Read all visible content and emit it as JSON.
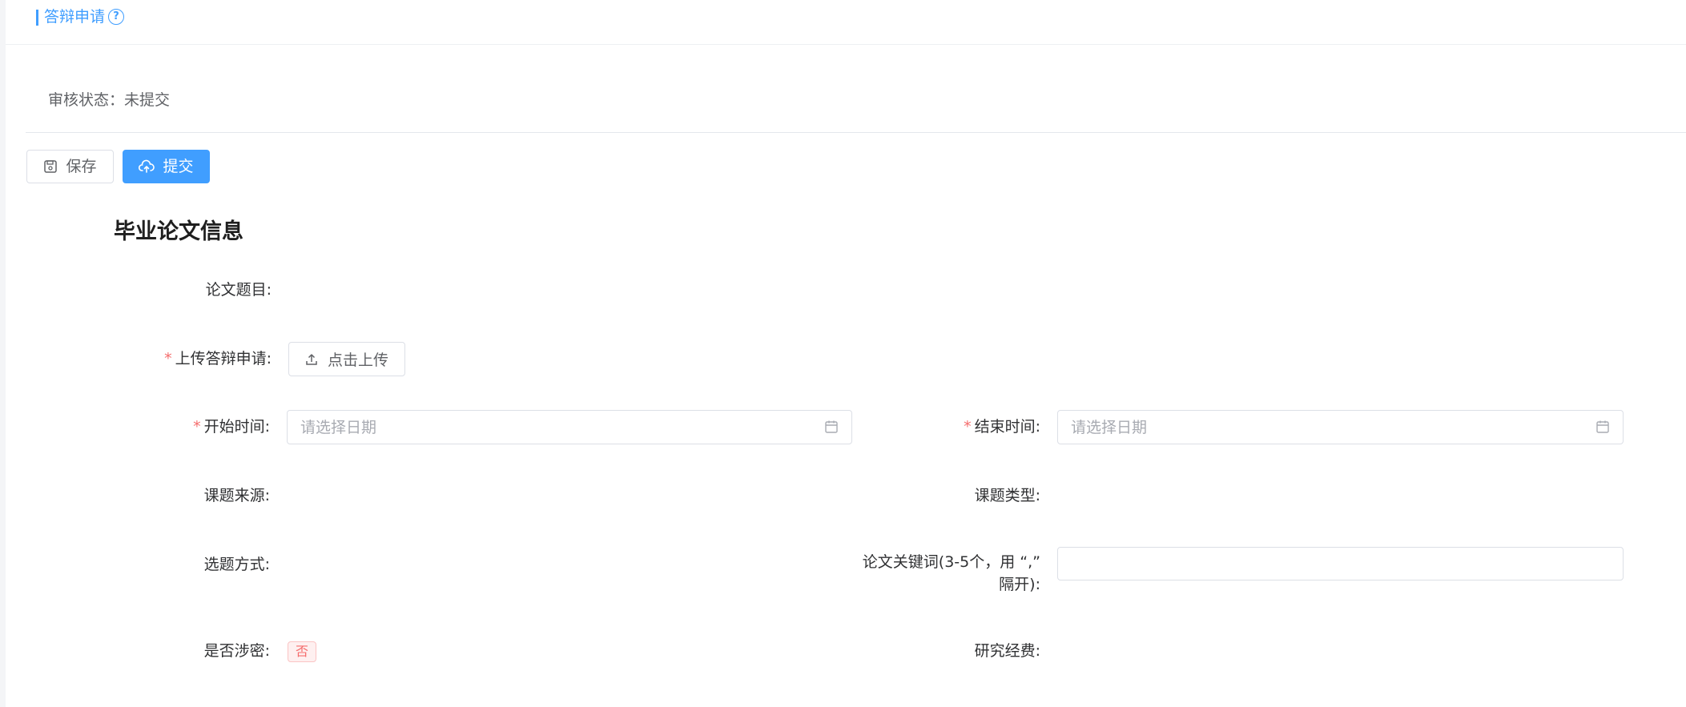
{
  "header": {
    "title": "答辩申请",
    "help_icon": "question-circle-icon"
  },
  "status": {
    "text": "审核状态：未提交"
  },
  "toolbar": {
    "save_label": "保存",
    "save_icon": "save-icon",
    "submit_label": "提交",
    "submit_icon": "upload-cloud-icon"
  },
  "section": {
    "title": "毕业论文信息"
  },
  "form": {
    "thesis_title_label": "论文题目:",
    "upload_label": "上传答辩申请:",
    "upload_button_label": "点击上传",
    "start_time_label": "开始时间:",
    "start_time_placeholder": "请选择日期",
    "end_time_label": "结束时间:",
    "end_time_placeholder": "请选择日期",
    "topic_source_label": "课题来源:",
    "topic_type_label": "课题类型:",
    "selection_method_label": "选题方式:",
    "keywords_label_line1": "论文关键词(3-5个，用 “,”",
    "keywords_label_line2": "隔开):",
    "confidential_label": "是否涉密:",
    "confidential_value": "否",
    "research_funding_label": "研究经费:"
  },
  "colors": {
    "primary": "#409eff",
    "required": "#f56c6c"
  }
}
